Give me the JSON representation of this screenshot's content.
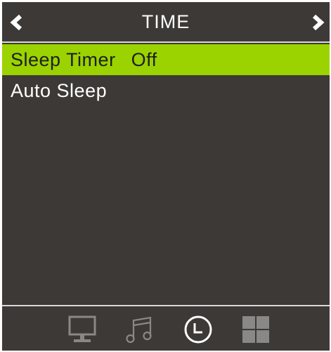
{
  "header": {
    "title": "TIME",
    "prev_icon": "chevron-left-icon",
    "next_icon": "chevron-right-icon"
  },
  "menu": {
    "items": [
      {
        "label": "Sleep Timer",
        "value": "Off",
        "selected": true
      },
      {
        "label": "Auto Sleep",
        "value": "",
        "selected": false
      }
    ]
  },
  "tabs": [
    {
      "icon": "monitor-icon",
      "active": false
    },
    {
      "icon": "music-note-icon",
      "active": false
    },
    {
      "icon": "clock-icon",
      "active": true
    },
    {
      "icon": "grid-icon",
      "active": false
    }
  ],
  "colors": {
    "background": "#3d3937",
    "highlight": "#9bd300",
    "text": "#ffffff",
    "inactive_icon": "#8a8886",
    "active_icon": "#ffffff"
  }
}
